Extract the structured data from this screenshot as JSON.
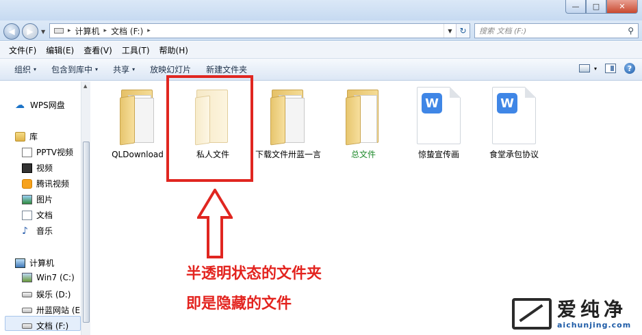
{
  "window": {
    "min_label": "—",
    "max_label": "□",
    "close_label": "✕"
  },
  "address": {
    "crumbs": [
      "计算机",
      "文档 (F:)"
    ],
    "separator": "▸",
    "search_placeholder": "搜索 文档 (F:)"
  },
  "menu": [
    "文件(F)",
    "编辑(E)",
    "查看(V)",
    "工具(T)",
    "帮助(H)"
  ],
  "toolbar": {
    "organize": "组织",
    "include_library": "包含到库中",
    "share": "共享",
    "slideshow": "放映幻灯片",
    "new_folder": "新建文件夹",
    "caret": "▾"
  },
  "nav": {
    "wps": "WPS网盘",
    "library": "库",
    "pptv": "PPTV视频",
    "video": "视频",
    "tencent": "腾讯视频",
    "pictures": "图片",
    "documents": "文档",
    "music": "音乐",
    "computer": "计算机",
    "win7": "Win7 (C:)",
    "ent": "娱乐 (D:)",
    "site": "卅蓝网站 (E",
    "docs_f": "文档 (F:)"
  },
  "files": [
    {
      "name": "QLDownload",
      "type": "folder"
    },
    {
      "name": "私人文件",
      "type": "folder-hidden"
    },
    {
      "name": "下载文件卅蓝一言",
      "type": "folder"
    },
    {
      "name": "总文件",
      "type": "folder"
    },
    {
      "name": "惊蛰宣传画",
      "type": "wps-doc"
    },
    {
      "name": "食堂承包协议",
      "type": "wps-doc"
    }
  ],
  "wps_badge": "W",
  "annotation": {
    "line1": "半透明状态的文件夹",
    "line2": "即是隐藏的文件"
  },
  "watermark": {
    "cn": "爱纯净",
    "url": "aichunjing.com"
  },
  "colors": {
    "annotation_red": "#e3241f",
    "accent_blue": "#3f86e6",
    "green_label": "#1e8a2b"
  }
}
